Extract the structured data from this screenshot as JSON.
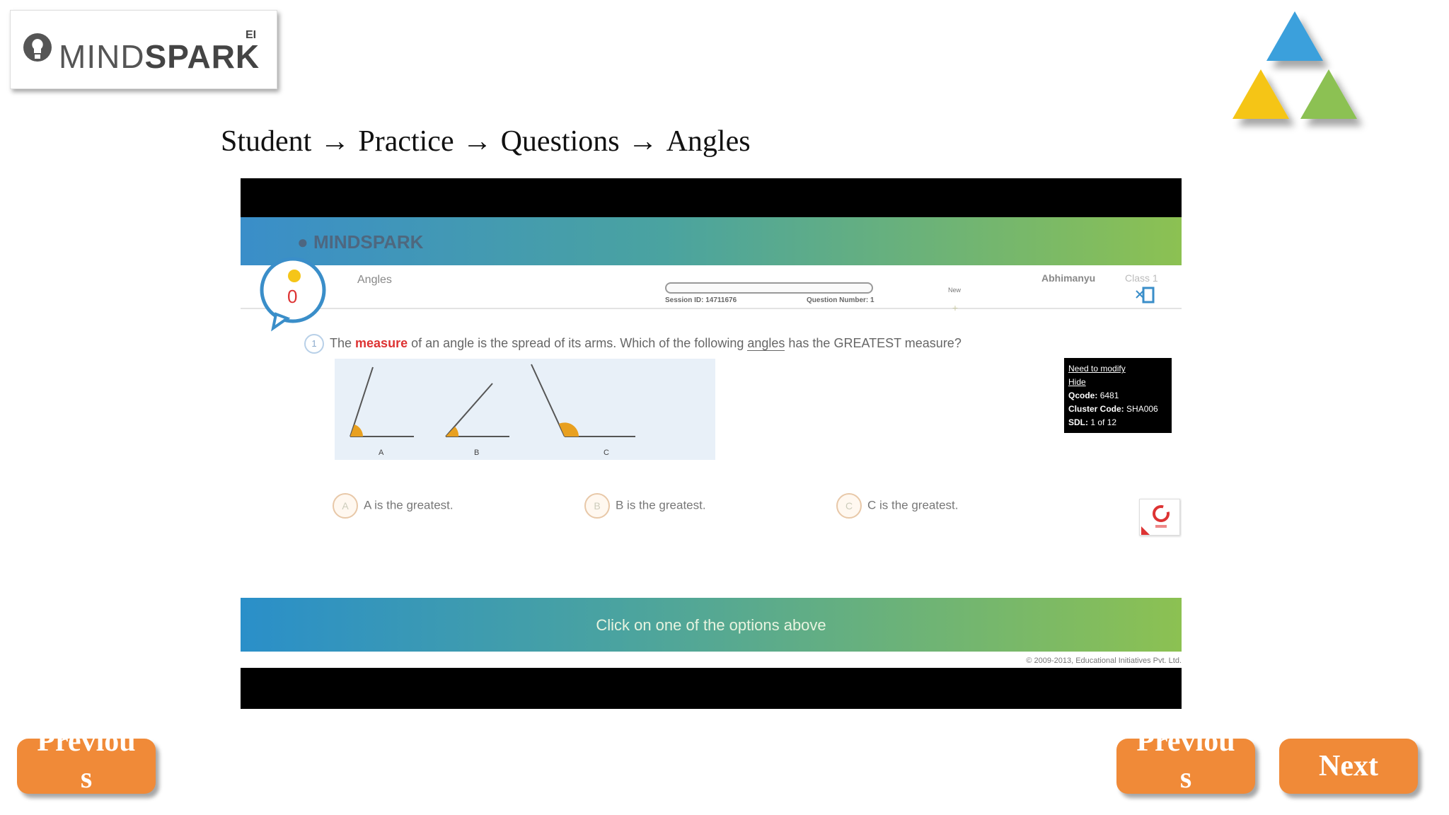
{
  "logo": {
    "brand_light": "MIND",
    "brand_bold": "SPARK",
    "superscript": "EI"
  },
  "breadcrumb": [
    "Student",
    "Practice",
    "Questions",
    "Angles"
  ],
  "breadcrumb_separator": "→",
  "embedded": {
    "app_logo": "MINDSPARK",
    "topic": "Angles",
    "session_id_label": "Session ID: 14711676",
    "question_number_label": "Question Number: 1",
    "new_label": "New",
    "plus": "+",
    "user_name": "Abhimanyu",
    "class_label": "Class 1",
    "sparkie_count": "0",
    "question": {
      "number": "1",
      "prefix": "The ",
      "highlight": "measure",
      "middle": " of an angle is the spread of its arms. Which of the following ",
      "underlined": "angles",
      "suffix": " has the GREATEST measure?"
    },
    "angle_labels": [
      "A",
      "B",
      "C"
    ],
    "info_box": {
      "line1": "Need to modify",
      "line2": "Hide",
      "qcode_label": "Qcode:",
      "qcode": "6481",
      "cluster_label": "Cluster Code:",
      "cluster": "SHA006",
      "sdl_label": "SDL:",
      "sdl": "1 of 12"
    },
    "options": [
      {
        "letter": "A",
        "text": "A is the greatest."
      },
      {
        "letter": "B",
        "text": "B is the greatest."
      },
      {
        "letter": "C",
        "text": "C is the greatest."
      }
    ],
    "footer_text": "Click on one of the options above",
    "copyright": "© 2009-2013, Educational Initiatives Pvt. Ltd."
  },
  "nav": {
    "previous_label": "Previous",
    "next_label": "Next"
  },
  "colors": {
    "orange": "#f08a38",
    "blue": "#3aa0dc",
    "yellow": "#f5c518",
    "green": "#8cc152"
  }
}
